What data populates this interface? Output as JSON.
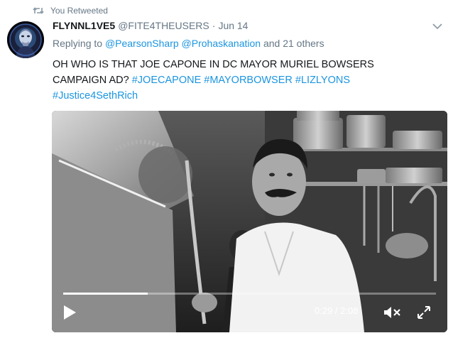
{
  "retweet_context": {
    "label": "You Retweeted",
    "icon": "retweet-icon"
  },
  "author": {
    "fullname": "FLYNNL1VE5",
    "username": "@FITE4THEUSERS",
    "separator": "·",
    "timestamp": "Jun 14"
  },
  "reply": {
    "prefix": "Replying to",
    "mentions": [
      "@PearsonSharp",
      "@Prohaskanation"
    ],
    "suffix": "and 21 others"
  },
  "text": {
    "body": "OH WHO IS THAT JOE CAPONE IN DC MAYOR MURIEL BOWSERS CAMPAIGN AD?",
    "hashtags": [
      "#JOECAPONE",
      "#MAYORBOWSER",
      "#LIZLYONS",
      "#Justice4SethRich"
    ]
  },
  "video": {
    "current_time": "0:29",
    "duration": "2:08",
    "time_label": "0:29 / 2:08",
    "progress_fraction": 0.227
  },
  "colors": {
    "link": "#1b95e0",
    "secondary_text": "#657786",
    "primary_text": "#14171a"
  }
}
